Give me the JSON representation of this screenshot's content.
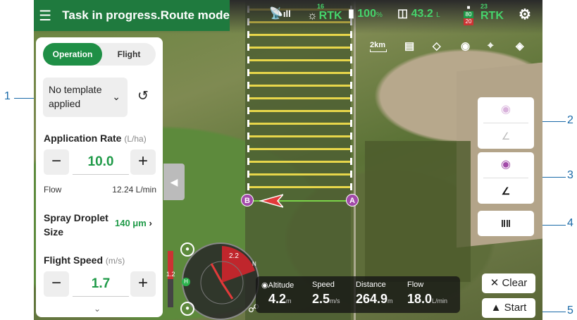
{
  "topbar": {
    "title": "Task in progress.Route mode",
    "rtk1_num": "16",
    "rtk1": "RTK",
    "battery": "100",
    "battery_unit": "%",
    "tank": "43.2",
    "tank_unit": "L",
    "rc_top": "80",
    "rc_bot": "20",
    "rtk2_num": "23",
    "rtk2": "RTK"
  },
  "tools": {
    "scale": "2km"
  },
  "panel": {
    "tab_operation": "Operation",
    "tab_flight": "Flight",
    "template": "No template applied",
    "app_rate_label": "Application Rate",
    "app_rate_unit": "(L/ha)",
    "app_rate_value": "10.0",
    "flow_label": "Flow",
    "flow_value": "12.24 L/min",
    "droplet_label": "Spray Droplet Size",
    "droplet_value": "140 μm",
    "speed_label": "Flight Speed",
    "speed_unit": "(m/s)",
    "speed_value": "1.7"
  },
  "map": {
    "marker_a": "A",
    "marker_b": "B"
  },
  "compass": {
    "value": "2.2",
    "side": "1.2",
    "n": "N",
    "h": "H"
  },
  "stats": [
    {
      "label": "Altitude",
      "value": "4.2",
      "unit": "m"
    },
    {
      "label": "Speed",
      "value": "2.5",
      "unit": "m/s"
    },
    {
      "label": "Distance",
      "value": "264.9",
      "unit": "m"
    },
    {
      "label": "Flow",
      "value": "18.0",
      "unit": "L/min"
    }
  ],
  "buttons": {
    "clear": "Clear",
    "start": "Start"
  },
  "callouts": [
    "1",
    "2",
    "3",
    "4",
    "5"
  ],
  "colors": {
    "accent": "#1f7a3e",
    "value_green": "#1f9a48",
    "marker": "#a24aa9",
    "callout": "#1a6aa8"
  }
}
